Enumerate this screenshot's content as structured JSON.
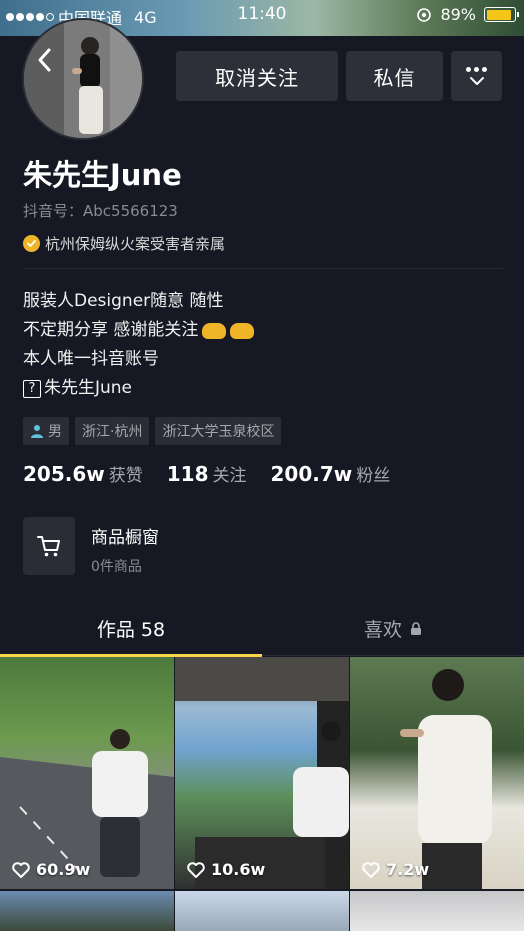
{
  "status_bar": {
    "carrier": "中国联通",
    "network": "4G",
    "time": "11:40",
    "battery": "89%",
    "battery_level": 0.89
  },
  "header": {
    "unfollow_label": "取消关注",
    "message_label": "私信"
  },
  "profile": {
    "name": "朱先生June",
    "douyin_id": "抖音号：Abc5566123",
    "verified_text": "杭州保姆纵火案受害者亲属",
    "bio": [
      "服装人Designer随意 随性",
      "不定期分享 感谢能关注",
      "本人唯一抖音账号",
      "朱先生June"
    ],
    "tags": [
      "男",
      "浙江·杭州",
      "浙江大学玉泉校区"
    ],
    "stats": [
      {
        "num": "205.6w",
        "label": "获赞"
      },
      {
        "num": "118",
        "label": "关注"
      },
      {
        "num": "200.7w",
        "label": "粉丝"
      }
    ],
    "shop": {
      "title": "商品橱窗",
      "subtitle": "0件商品"
    }
  },
  "tabs": {
    "works": "作品 58",
    "likes": "喜欢"
  },
  "videos": [
    {
      "likes": "60.9w"
    },
    {
      "likes": "10.6w"
    },
    {
      "likes": "7.2w"
    }
  ],
  "colors": {
    "background": "#161823",
    "accent": "#f7d44a",
    "button": "#2e3039",
    "muted_text": "#a6a7ad"
  }
}
